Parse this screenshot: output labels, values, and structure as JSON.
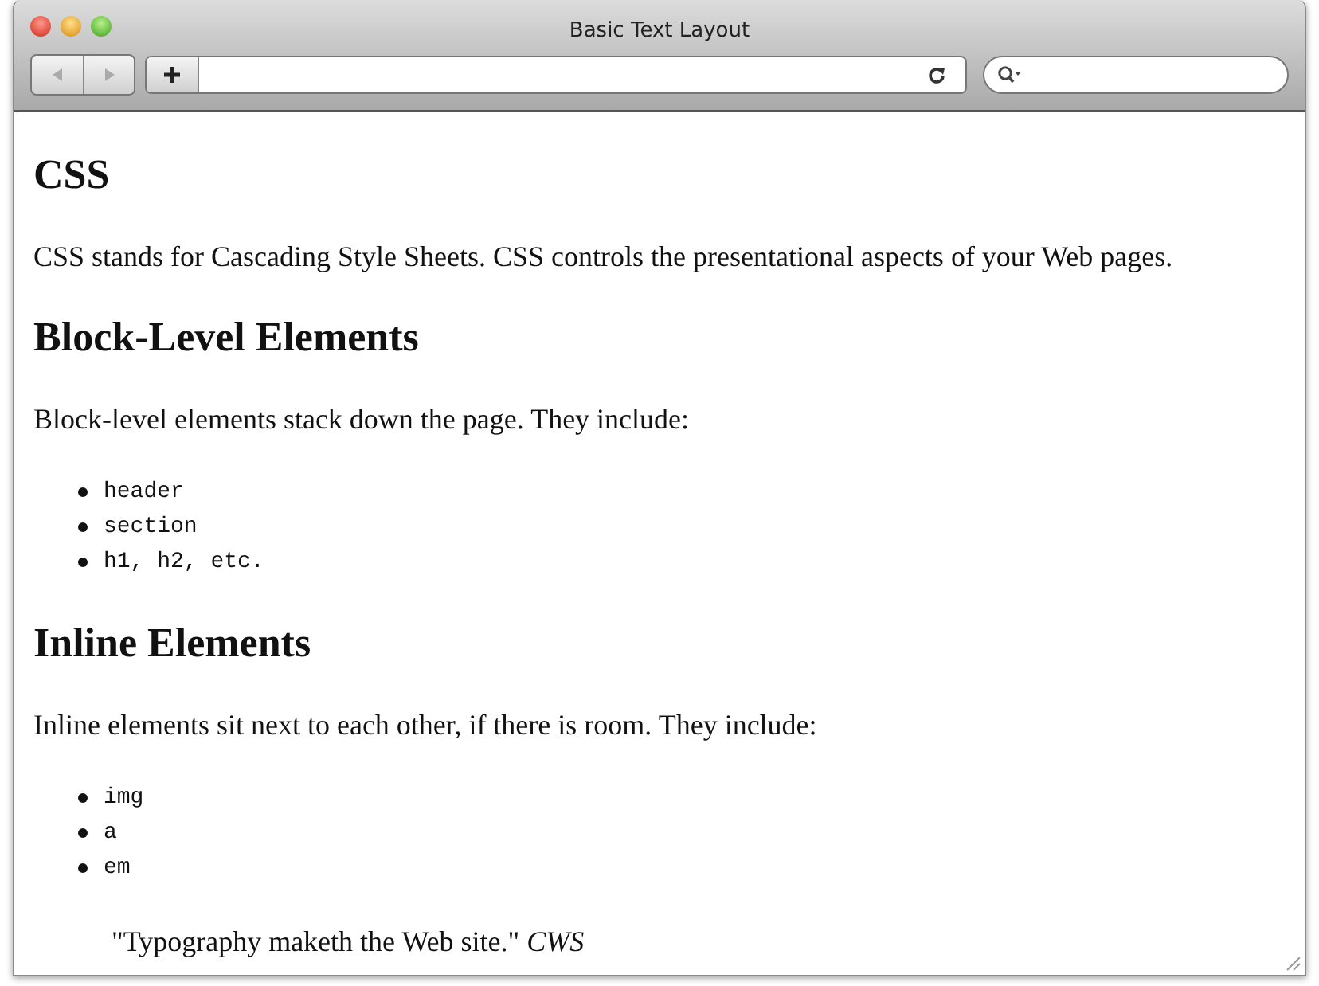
{
  "window": {
    "title": "Basic Text Layout"
  },
  "content": [
    {
      "kind": "heading",
      "text": "CSS"
    },
    {
      "kind": "paragraph",
      "text": "CSS stands for Cascading Style Sheets. CSS controls the presentational aspects of your Web pages."
    },
    {
      "kind": "heading",
      "text": "Block-Level Elements"
    },
    {
      "kind": "paragraph",
      "text": "Block-level elements stack down the page. They include:"
    },
    {
      "kind": "list",
      "items": [
        "header",
        "section",
        "h1, h2, etc."
      ]
    },
    {
      "kind": "heading",
      "text": "Inline Elements"
    },
    {
      "kind": "paragraph",
      "text": "Inline elements sit next to each other, if there is room. They include:"
    },
    {
      "kind": "list",
      "items": [
        "img",
        "a",
        "em"
      ]
    },
    {
      "kind": "quote",
      "text": "\"Typography maketh the Web site.\" *CWS*"
    }
  ]
}
